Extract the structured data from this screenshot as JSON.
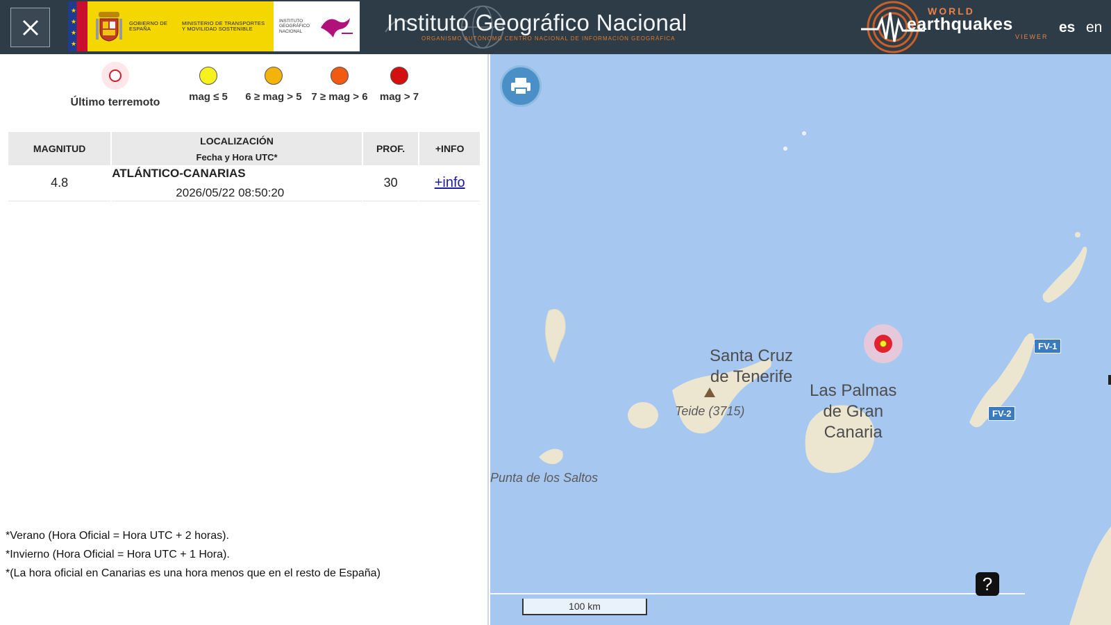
{
  "header": {
    "gov_text": "Gobierno de España",
    "ministry_text": "Ministerio de Transportes y Movilidad Sostenible",
    "ign_small": "Instituto Geográfico Nacional",
    "ign_title": "Instituto Geográfico Nacional",
    "ign_subtitle": "Organismo Autónomo Centro Nacional de Información Geográfica",
    "weq_world": "WORLD",
    "weq_name": "earthquakes",
    "weq_viewer": "VIEWER",
    "lang_es": "es",
    "lang_en": "en"
  },
  "legend": {
    "last": "Último terremoto",
    "items": [
      {
        "label": "mag ≤ 5",
        "color": "#f7f21d"
      },
      {
        "label": "6 ≥ mag > 5",
        "color": "#f4b30b"
      },
      {
        "label": "7 ≥ mag > 6",
        "color": "#f05a12"
      },
      {
        "label": "mag > 7",
        "color": "#d40f0f"
      }
    ]
  },
  "table": {
    "headers": {
      "magnitude": "MAGNITUD",
      "location": "LOCALIZACIÓN",
      "datetime": "Fecha y Hora UTC*",
      "depth": "PROF.",
      "info": "+INFO"
    },
    "rows": [
      {
        "magnitude": "4.8",
        "location": "ATLÁNTICO-CANARIAS",
        "datetime": "2026/05/22 08:50:20",
        "depth": "30",
        "info": "+info"
      }
    ]
  },
  "notes": [
    "*Verano (Hora Oficial = Hora UTC + 2 horas).",
    "*Invierno (Hora Oficial = Hora UTC + 1 Hora).",
    "*(La hora oficial en Canarias es una hora menos que en el resto de España)"
  ],
  "map": {
    "label_tenerife_1": "Santa Cruz",
    "label_tenerife_2": "de Tenerife",
    "label_laspalmas_1": "Las Palmas",
    "label_laspalmas_2": "de Gran",
    "label_laspalmas_3": "Canaria",
    "label_teide": "Teide (3715)",
    "label_punta": "Punta de los Saltos",
    "road_fv1": "FV-1",
    "road_fv2": "FV-2",
    "scale": "100 km",
    "help": "?",
    "colors": {
      "sea": "#a6c8f0",
      "land": "#ece5cf",
      "marker": "#e2222f"
    }
  }
}
